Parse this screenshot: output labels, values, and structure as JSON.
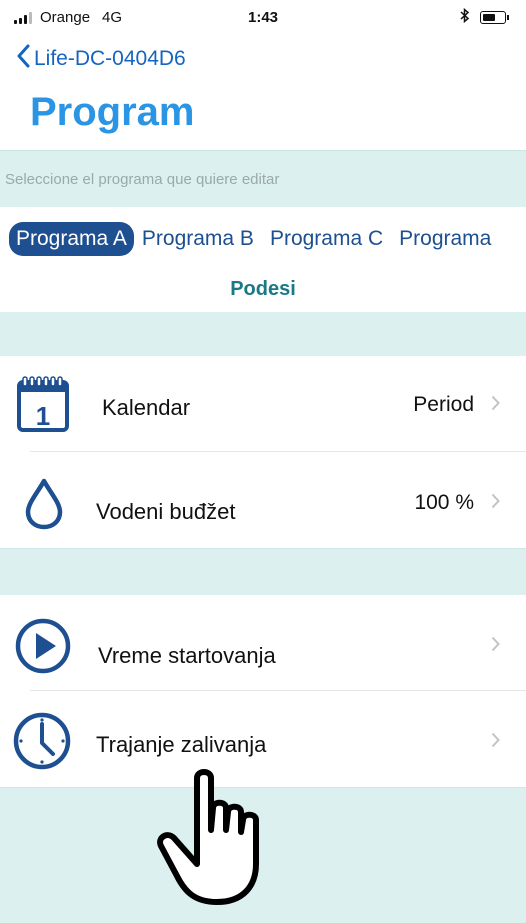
{
  "status_bar": {
    "carrier": "Orange",
    "network": "4G",
    "time": "1:43"
  },
  "nav": {
    "back_label": "Life-DC-0404D6",
    "title": "Program"
  },
  "hint": "Seleccione el programa que quiere editar",
  "tabs": [
    {
      "label": "Programa A",
      "active": true
    },
    {
      "label": "Programa B",
      "active": false
    },
    {
      "label": "Programa C",
      "active": false
    },
    {
      "label": "Programa",
      "active": false
    }
  ],
  "section_title": "Podesi",
  "calendar_icon": {
    "day": "1"
  },
  "rows": [
    {
      "label": "Kalendar",
      "value": "Period",
      "icon": "calendar-icon"
    },
    {
      "label": "Vodeni buđžet",
      "value": "100 %",
      "icon": "water-drop-icon"
    },
    {
      "label": "Vreme startovanja",
      "value": "",
      "icon": "play-circle-icon"
    },
    {
      "label": "Trajanje zalivanja",
      "value": "",
      "icon": "clock-icon"
    }
  ],
  "colors": {
    "accent": "#1d4f91",
    "title": "#2a95e4",
    "band": "#dcf1ef",
    "section": "#197a85"
  }
}
